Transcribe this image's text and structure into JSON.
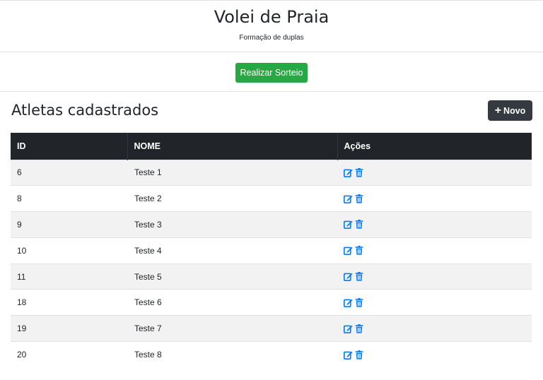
{
  "header": {
    "title": "Volei de Praia",
    "subtitle": "Formação de duplas"
  },
  "actions": {
    "sorteio_label": "Realizar Sorteio"
  },
  "section": {
    "title": "Atletas cadastrados",
    "new_button_icon": "plus-icon",
    "new_button_label": "Novo"
  },
  "table": {
    "columns": [
      "ID",
      "NOME",
      "Ações"
    ],
    "rows": [
      {
        "id": "6",
        "nome": "Teste 1"
      },
      {
        "id": "8",
        "nome": "Teste 2"
      },
      {
        "id": "9",
        "nome": "Teste 3"
      },
      {
        "id": "10",
        "nome": "Teste 4"
      },
      {
        "id": "11",
        "nome": "Teste 5"
      },
      {
        "id": "18",
        "nome": "Teste 6"
      },
      {
        "id": "19",
        "nome": "Teste 7"
      },
      {
        "id": "20",
        "nome": "Teste 8"
      }
    ],
    "row_action_icons": [
      "edit-icon",
      "trash-icon"
    ]
  },
  "colors": {
    "success": "#28a745",
    "dark": "#343a40",
    "table_header": "#212529",
    "icon_blue": "#007bff",
    "stripe": "#f2f2f2"
  }
}
